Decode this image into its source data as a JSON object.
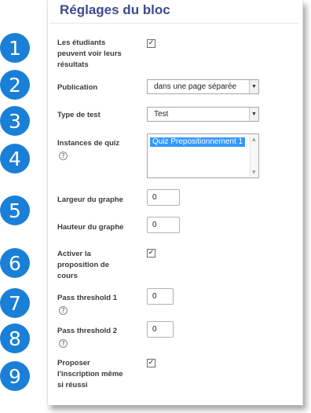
{
  "section_title": "Réglages du bloc",
  "markers": [
    "1",
    "2",
    "3",
    "4",
    "5",
    "6",
    "7",
    "8",
    "9"
  ],
  "fields": {
    "students_see_results": {
      "label_lines": [
        "Les étudiants",
        "peuvent voir leurs",
        "résultats"
      ],
      "checked": true
    },
    "publication": {
      "label": "Publication",
      "value": "dans une page séparée"
    },
    "test_type": {
      "label": "Type de test",
      "value": "Test"
    },
    "quiz_instances": {
      "label": "Instances de quiz",
      "options": [
        "Quiz Prepositionnement 1"
      ]
    },
    "graph_width": {
      "label": "Largeur du graphe",
      "value": "0"
    },
    "graph_height": {
      "label": "Hauteur du graphe",
      "value": "0"
    },
    "course_proposal": {
      "label_lines": [
        "Activer la",
        "proposition de",
        "cours"
      ],
      "checked": true
    },
    "pass_threshold_1": {
      "label": "Pass threshold 1",
      "value": "0"
    },
    "pass_threshold_2": {
      "label": "Pass threshold 2",
      "value": "0"
    },
    "propose_enrolment": {
      "label_lines": [
        "Proposer",
        "l'inscription même",
        "si réussi"
      ],
      "checked": true
    }
  },
  "icons": {
    "help": "help-icon",
    "checkbox_tick": "check-icon",
    "dropdown": "chevron-down-icon"
  },
  "colors": {
    "marker": "#1a7fd6",
    "title": "#3f4b8c",
    "selection": "#3399ff"
  }
}
